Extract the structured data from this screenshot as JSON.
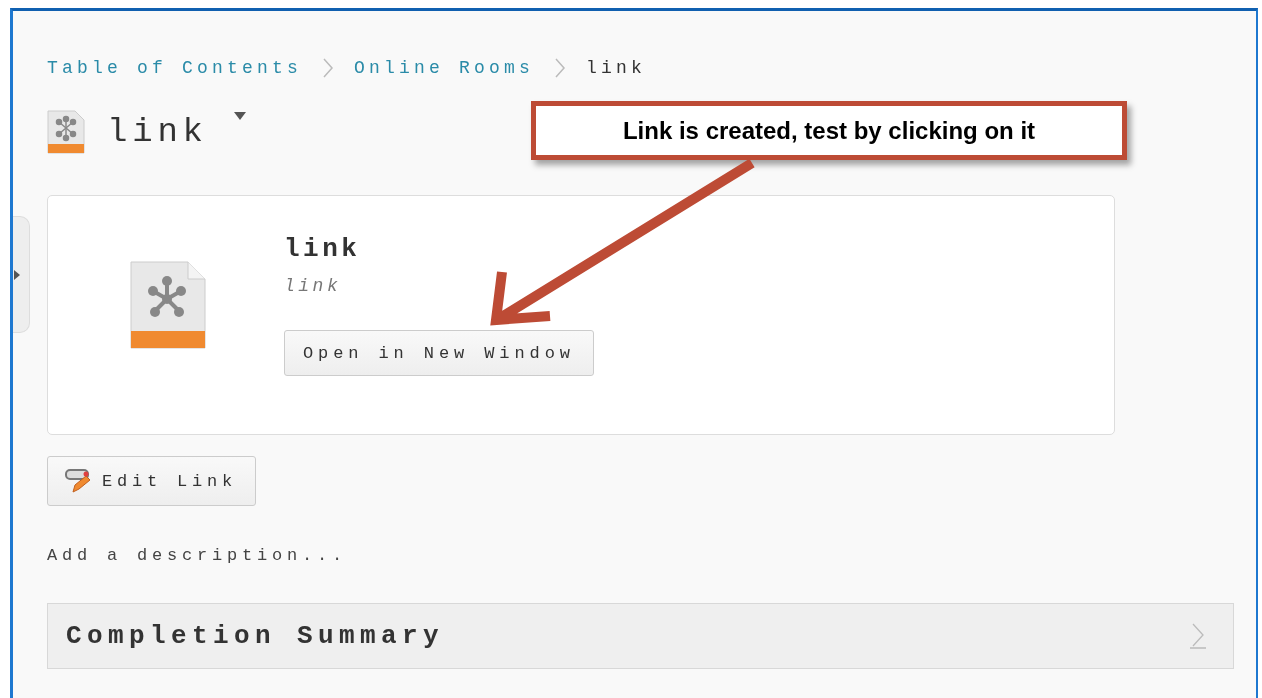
{
  "breadcrumb": [
    {
      "label": "Table of Contents",
      "kind": "link"
    },
    {
      "label": "Online Rooms",
      "kind": "link"
    },
    {
      "label": "link",
      "kind": "current"
    }
  ],
  "title": "link",
  "card": {
    "title": "link",
    "subtitle": "link",
    "button": "Open in New Window"
  },
  "edit_button": "Edit Link",
  "description": {
    "placeholder": "Add a description..."
  },
  "completion_summary": {
    "title": "Completion Summary",
    "expanded": false
  },
  "callout": "Link is created, test by clicking on it"
}
